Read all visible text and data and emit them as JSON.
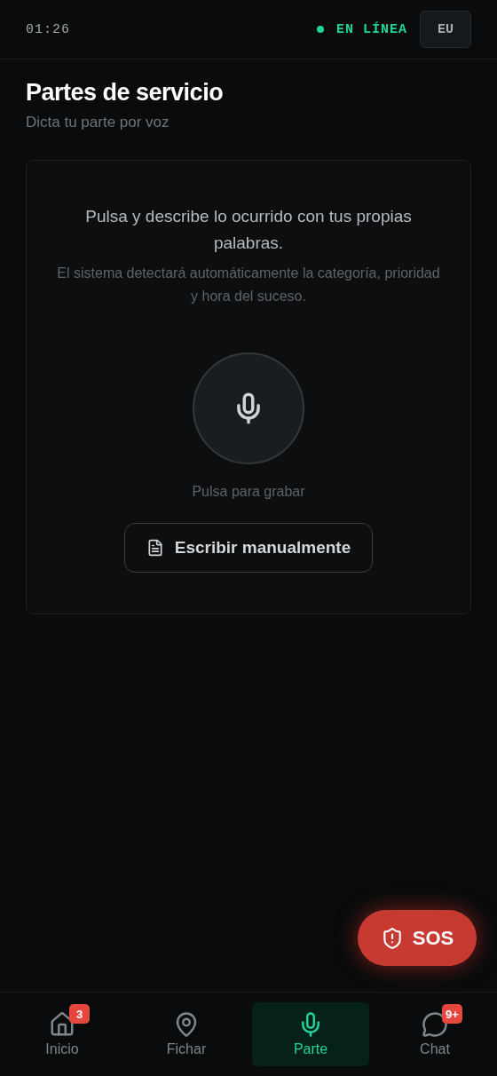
{
  "status_bar": {
    "time": "01:26",
    "connection": {
      "label": "EN LÍNEA",
      "online": true
    },
    "language": "EU"
  },
  "header": {
    "title": "Partes de servicio",
    "subtitle": "Dicta tu parte por voz"
  },
  "recorder": {
    "prompt": "Pulsa y describe lo ocurrido con tus propias palabras.",
    "hint": "El sistema detectará automáticamente la categoría, prioridad y hora del suceso.",
    "recording": false,
    "record_label": "Pulsa para grabar",
    "manual_button": "Escribir manualmente"
  },
  "sos_button": "SOS",
  "nav": [
    {
      "kind": "home",
      "label": "Inicio",
      "badge": "3",
      "selected": false
    },
    {
      "kind": "pin",
      "label": "Fichar",
      "selected": false
    },
    {
      "kind": "mic",
      "label": "Parte",
      "selected": true
    },
    {
      "kind": "chat",
      "label": "Chat",
      "badge": "9+",
      "selected": false
    }
  ]
}
